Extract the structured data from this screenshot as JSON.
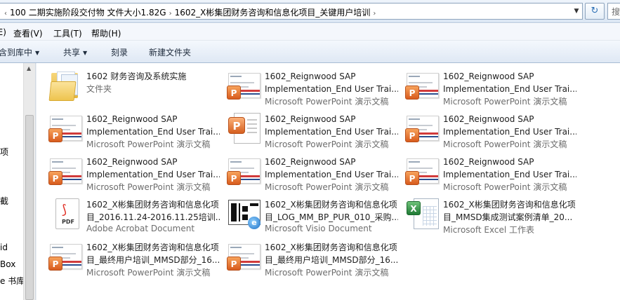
{
  "address_bar": {
    "crumbs": [
      "100 二期实施阶段交付物 文件大小1.82G",
      "1602_X彬集团财务咨询和信息化项目_关键用户培训"
    ],
    "search_placeholder": "搜"
  },
  "menu": {
    "items": [
      {
        "label": "(E)"
      },
      {
        "label": "查看(V)"
      },
      {
        "label": "工具(T)"
      },
      {
        "label": "帮助(H)"
      }
    ]
  },
  "toolbar": {
    "include_library": "含到库中",
    "share": "共享",
    "burn": "刻录",
    "new_folder": "新建文件夹"
  },
  "nav": {
    "labels": [
      "项",
      "截",
      "id",
      "Box",
      "e 书库"
    ]
  },
  "files": [
    {
      "name_line1": "1602 财务咨询及系统实施",
      "name_line2": "",
      "type": "文件夹",
      "icon": "folder-icon"
    },
    {
      "name_line1": "1602_Reignwood SAP",
      "name_line2": "Implementation_End User Trai...",
      "type": "Microsoft PowerPoint 演示文稿",
      "icon": "ppt-slide-icon"
    },
    {
      "name_line1": "1602_Reignwood SAP",
      "name_line2": "Implementation_End User Trai...",
      "type": "Microsoft PowerPoint 演示文稿",
      "icon": "ppt-slide-icon"
    },
    {
      "name_line1": "1602_Reignwood SAP",
      "name_line2": "Implementation_End User Trai...",
      "type": "Microsoft PowerPoint 演示文稿",
      "icon": "ppt-slide-icon"
    },
    {
      "name_line1": "1602_Reignwood SAP",
      "name_line2": "Implementation_End User Trai...",
      "type": "Microsoft PowerPoint 演示文稿",
      "icon": "ppt-doc-icon"
    },
    {
      "name_line1": "1602_Reignwood SAP",
      "name_line2": "Implementation_End User Trai...",
      "type": "Microsoft PowerPoint 演示文稿",
      "icon": "ppt-slide-icon"
    },
    {
      "name_line1": "1602_Reignwood SAP",
      "name_line2": "Implementation_End User Trai...",
      "type": "Microsoft PowerPoint 演示文稿",
      "icon": "ppt-slide-icon"
    },
    {
      "name_line1": "1602_Reignwood SAP",
      "name_line2": "Implementation_End User Trai...",
      "type": "Microsoft PowerPoint 演示文稿",
      "icon": "ppt-slide-icon"
    },
    {
      "name_line1": "1602_Reignwood SAP",
      "name_line2": "Implementation_End User Trai...",
      "type": "Microsoft PowerPoint 演示文稿",
      "icon": "ppt-slide-icon"
    },
    {
      "name_line1": "1602_X彬集团财务咨询和信息化项",
      "name_line2": "目_2016.11.24-2016.11.25培训...",
      "type": "Adobe Acrobat Document",
      "icon": "pdf-icon"
    },
    {
      "name_line1": "1602_X彬集团财务咨询和信息化项",
      "name_line2": "目_LOG_MM_BP_PUR_010_采购...",
      "type": "Microsoft Visio Document",
      "icon": "visio-icon"
    },
    {
      "name_line1": "1602_X彬集团财务咨询和信息化项",
      "name_line2": "目_MMSD集成测试案例清单_20...",
      "type": "Microsoft Excel 工作表",
      "icon": "excel-icon"
    },
    {
      "name_line1": "1602_X彬集团财务咨询和信息化项",
      "name_line2": "目_最终用户培训_MMSD部分_16...",
      "type": "Microsoft PowerPoint 演示文稿",
      "icon": "ppt-slide-icon"
    },
    {
      "name_line1": "1602_X彬集团财务咨询和信息化项",
      "name_line2": "目_最终用户培训_MMSD部分_16...",
      "type": "Microsoft PowerPoint 演示文稿",
      "icon": "ppt-slide-icon"
    }
  ],
  "colors": {
    "type_text": "#6d6d6d",
    "pdf_red": "#e02b20",
    "ppt_orange": "#d85b1d",
    "excel_green": "#1f7a34"
  }
}
